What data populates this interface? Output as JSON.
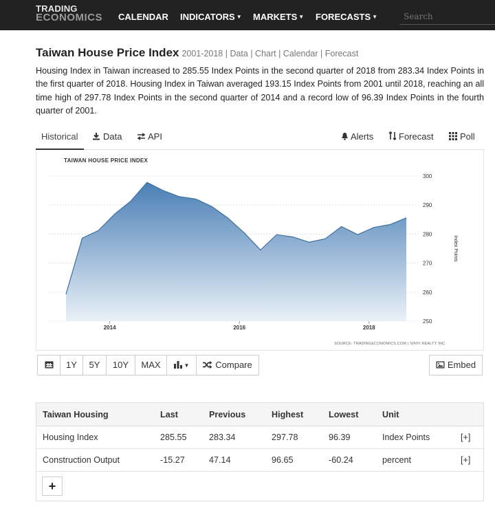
{
  "nav": {
    "logo_line1": "TRADING",
    "logo_line2": "ECONOMICS",
    "items": [
      {
        "label": "CALENDAR",
        "caret": ""
      },
      {
        "label": "INDICATORS",
        "caret": "▼"
      },
      {
        "label": "MARKETS",
        "caret": "▼"
      },
      {
        "label": "FORECASTS",
        "caret": "▼"
      }
    ],
    "search_placeholder": "Search"
  },
  "header": {
    "title": "Taiwan House Price Index",
    "subtitle": "2001-2018 | Data | Chart | Calendar | Forecast",
    "description": "Housing Index in Taiwan increased to 285.55 Index Points in the second quarter of 2018 from 283.34 Index Points in the first quarter of 2018. Housing Index in Taiwan averaged 193.15 Index Points from 2001 until 2018, reaching an all time high of 297.78 Index Points in the second quarter of 2014 and a record low of 96.39 Index Points in the fourth quarter of 2001."
  },
  "tabs": {
    "historical": "Historical",
    "data": "Data",
    "api": "API",
    "alerts": "Alerts",
    "forecast": "Forecast",
    "poll": "Poll"
  },
  "chart_data": {
    "type": "area",
    "title": "TAIWAN HOUSE PRICE INDEX",
    "ylabel": "Index Points",
    "xlabel": "",
    "ylim": [
      250,
      300
    ],
    "yticks": [
      250,
      260,
      270,
      280,
      290,
      300
    ],
    "xticks": [
      "2014",
      "2016",
      "2018"
    ],
    "grid": true,
    "color": "#4f81bd",
    "x": [
      "2013-Q1",
      "2013-Q2",
      "2013-Q3",
      "2013-Q4",
      "2014-Q1",
      "2014-Q2",
      "2014-Q3",
      "2014-Q4",
      "2015-Q1",
      "2015-Q2",
      "2015-Q3",
      "2015-Q4",
      "2016-Q1",
      "2016-Q2",
      "2016-Q3",
      "2016-Q4",
      "2017-Q1",
      "2017-Q2",
      "2017-Q3",
      "2017-Q4",
      "2018-Q1",
      "2018-Q2"
    ],
    "values": [
      259.3,
      278.6,
      281.2,
      286.9,
      291.4,
      297.8,
      295.0,
      292.9,
      292.1,
      289.5,
      285.5,
      280.4,
      274.5,
      279.8,
      279.0,
      277.2,
      278.4,
      282.6,
      279.8,
      282.3,
      283.3,
      285.6
    ],
    "source": "SOURCE: TRADINGECONOMICS.COM | SINYI REALTY INC."
  },
  "controls": {
    "calendar_icon": "calendar-icon",
    "ranges": [
      "1Y",
      "5Y",
      "10Y",
      "MAX"
    ],
    "chart_type_icon": "bar-chart-icon",
    "chart_type_caret": "▼",
    "compare": "Compare",
    "embed": "Embed"
  },
  "table": {
    "headers": [
      "Taiwan Housing",
      "Last",
      "Previous",
      "Highest",
      "Lowest",
      "Unit"
    ],
    "rows": [
      [
        "Housing Index",
        "285.55",
        "283.34",
        "297.78",
        "96.39",
        "Index Points",
        "[+]"
      ],
      [
        "Construction Output",
        "-15.27",
        "47.14",
        "96.65",
        "-60.24",
        "percent",
        "[+]"
      ]
    ],
    "add_label": "+"
  },
  "colors": {
    "navbar": "#222222",
    "area_top": "#4a7fb5",
    "area_bottom": "#eaf1f8",
    "line": "#3f6f9f"
  }
}
